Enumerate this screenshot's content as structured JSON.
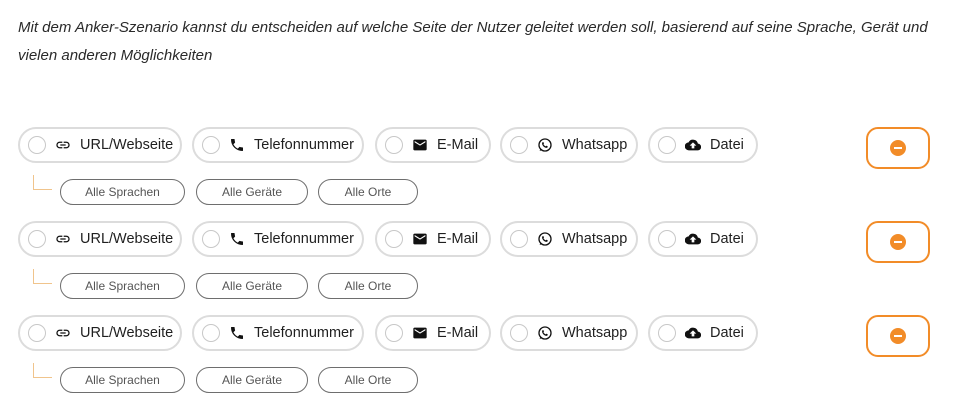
{
  "intro_text": "Mit dem Anker-Szenario kannst du entscheiden auf welche Seite der Nutzer geleitet werden soll, basierend auf seine Sprache, Gerät und vielen anderen Möglichkeiten",
  "colors": {
    "accent": "#f28c28",
    "border": "#dcdcdc",
    "connector": "#f0c48c"
  },
  "scenarios": [
    {
      "types": [
        {
          "label": "URL/Webseite",
          "icon": "link-icon"
        },
        {
          "label": "Telefonnummer",
          "icon": "phone-icon"
        },
        {
          "label": "E-Mail",
          "icon": "mail-icon"
        },
        {
          "label": "Whatsapp",
          "icon": "whatsapp-icon"
        },
        {
          "label": "Datei",
          "icon": "cloud-upload-icon"
        }
      ],
      "filters": [
        {
          "label": "Alle Sprachen"
        },
        {
          "label": "Alle Geräte"
        },
        {
          "label": "Alle Orte"
        }
      ],
      "remove_icon": "minus-circle-icon"
    },
    {
      "types": [
        {
          "label": "URL/Webseite",
          "icon": "link-icon"
        },
        {
          "label": "Telefonnummer",
          "icon": "phone-icon"
        },
        {
          "label": "E-Mail",
          "icon": "mail-icon"
        },
        {
          "label": "Whatsapp",
          "icon": "whatsapp-icon"
        },
        {
          "label": "Datei",
          "icon": "cloud-upload-icon"
        }
      ],
      "filters": [
        {
          "label": "Alle Sprachen"
        },
        {
          "label": "Alle Geräte"
        },
        {
          "label": "Alle Orte"
        }
      ],
      "remove_icon": "minus-circle-icon"
    },
    {
      "types": [
        {
          "label": "URL/Webseite",
          "icon": "link-icon"
        },
        {
          "label": "Telefonnummer",
          "icon": "phone-icon"
        },
        {
          "label": "E-Mail",
          "icon": "mail-icon"
        },
        {
          "label": "Whatsapp",
          "icon": "whatsapp-icon"
        },
        {
          "label": "Datei",
          "icon": "cloud-upload-icon"
        }
      ],
      "filters": [
        {
          "label": "Alle Sprachen"
        },
        {
          "label": "Alle Geräte"
        },
        {
          "label": "Alle Orte"
        }
      ],
      "remove_icon": "minus-circle-icon"
    }
  ]
}
